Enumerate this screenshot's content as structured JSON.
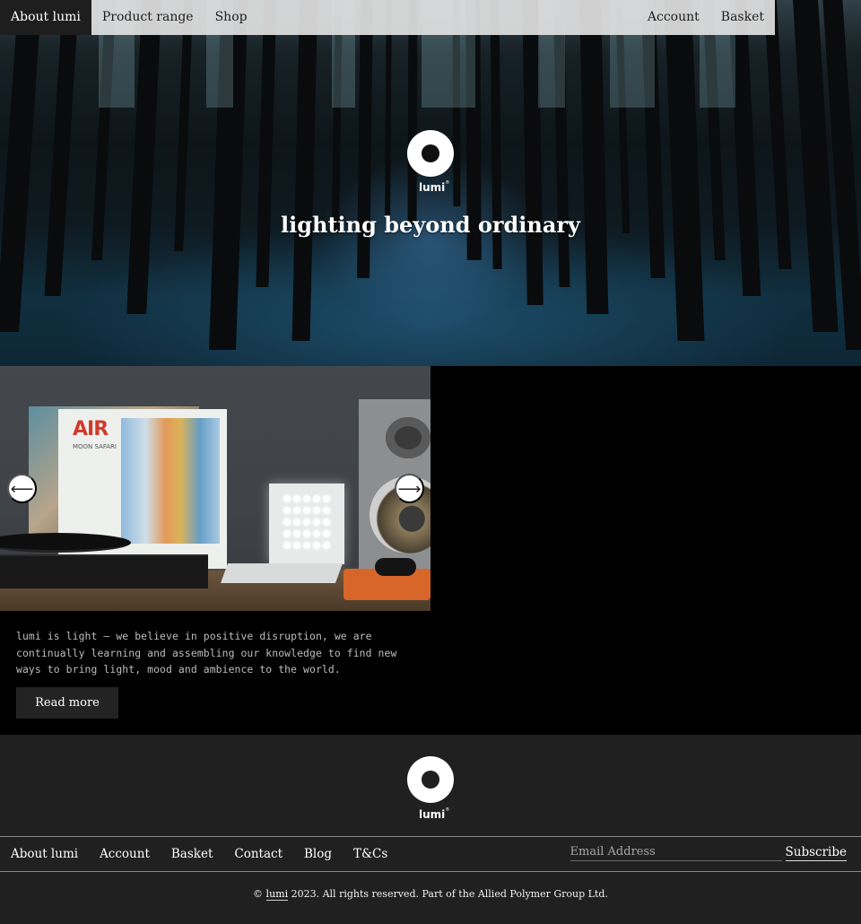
{
  "nav": {
    "left": [
      {
        "label": "About lumi",
        "active": true
      },
      {
        "label": "Product range",
        "active": false
      },
      {
        "label": "Shop",
        "active": false
      }
    ],
    "right": [
      {
        "label": "Account"
      },
      {
        "label": "Basket"
      }
    ]
  },
  "hero": {
    "logo_word": "lumi",
    "logo_mark": "®",
    "title": "lighting beyond ordinary"
  },
  "slider": {
    "prev_icon": "arrow-left-icon",
    "next_icon": "arrow-right-icon",
    "prev_glyph": "⟵",
    "next_glyph": "⟶",
    "album_title": "MOON SAFARI",
    "album_artist": "AIR"
  },
  "about": {
    "text": "lumi is light — we believe in positive disruption, we are continually learning and assembling our knowledge to find new ways to bring light, mood and ambience to the world.",
    "read_more": "Read more"
  },
  "footer": {
    "logo_word": "lumi",
    "logo_mark": "®",
    "links": [
      {
        "label": "About lumi"
      },
      {
        "label": "Account"
      },
      {
        "label": "Basket"
      },
      {
        "label": "Contact"
      },
      {
        "label": "Blog"
      },
      {
        "label": "T&Cs"
      }
    ],
    "email_placeholder": "Email Address",
    "subscribe": "Subscribe",
    "copyright": {
      "prefix": "©",
      "brand": "lumi",
      "suffix": "2023. All rights reserved. Part of the Allied Polymer Group Ltd."
    }
  },
  "colors": {
    "nav_bg": "#e2e2e2",
    "nav_active_bg": "#1e1e1e",
    "content_bg": "#000000",
    "footer_bg": "#202020",
    "button_bg": "#232323"
  }
}
